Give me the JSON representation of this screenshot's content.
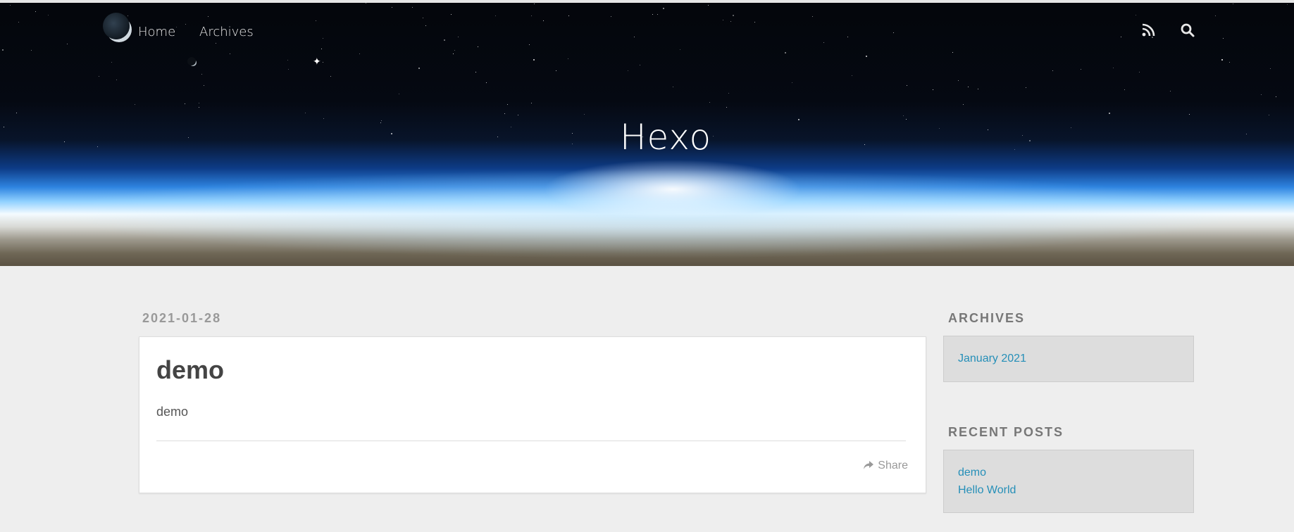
{
  "nav": {
    "home_label": "Home",
    "archives_label": "Archives",
    "rss_icon": "rss-icon",
    "search_icon": "search-icon"
  },
  "banner": {
    "site_title": "Hexo"
  },
  "post": {
    "date": "2021-01-28",
    "title": "demo",
    "body": "demo",
    "share_label": "Share",
    "share_icon": "share-arrow-icon"
  },
  "sidebar": {
    "archives": {
      "title": "ARCHIVES",
      "items": [
        "January 2021"
      ]
    },
    "recent_posts": {
      "title": "RECENT POSTS",
      "items": [
        "demo",
        "Hello World"
      ]
    }
  },
  "colors": {
    "link": "#258fb8",
    "page_background": "#eeeeee",
    "widget_background": "#dddddd"
  }
}
